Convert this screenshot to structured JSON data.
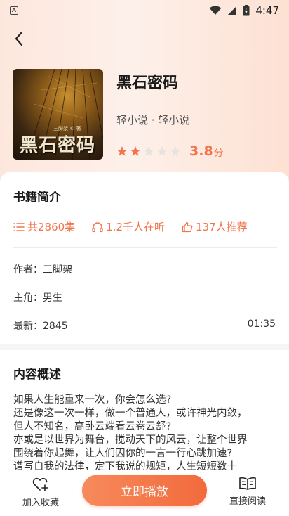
{
  "status_bar": {
    "time": "4:47",
    "left_badge": "A"
  },
  "book": {
    "title": "黑石密码",
    "category": "轻小说 · 轻小说",
    "rating": 3.8,
    "rating_text": "3.8",
    "rating_unit": "分",
    "stars_max": 5,
    "cover_title": "黑石密码",
    "cover_author": "三脚架 © 著"
  },
  "intro": {
    "heading": "书籍简介",
    "episodes": "共2860集",
    "listeners": "1.2千人在听",
    "recommends": "137人推荐",
    "author_label": "作者：",
    "author": "三脚架",
    "lead_label": "主角：",
    "lead": "男生",
    "latest_label": "最新：",
    "latest": "2845",
    "latest_time": "01:35"
  },
  "summary": {
    "heading": "内容概述",
    "lines": [
      "如果人生能重来一次，你会怎么选?",
      "还是像这一次一样，做一个普通人，或许神光内敛，",
      "但人不知名，高卧云端看云卷云舒?",
      "亦或是以世界为舞台，搅动天下的风云，让整个世界",
      "围绕着你起舞，让人们因你的一言一行心跳加速?",
      "谱写自我的法律，定下我说的规矩，人生短短数十"
    ]
  },
  "bottom": {
    "favorite_label": "加入收藏",
    "play_label": "立即播放",
    "read_label": "直接阅读"
  },
  "colors": {
    "accent": "#f2744a",
    "hero_bg": "#fde7dd",
    "play_button": "#f26a3c"
  }
}
